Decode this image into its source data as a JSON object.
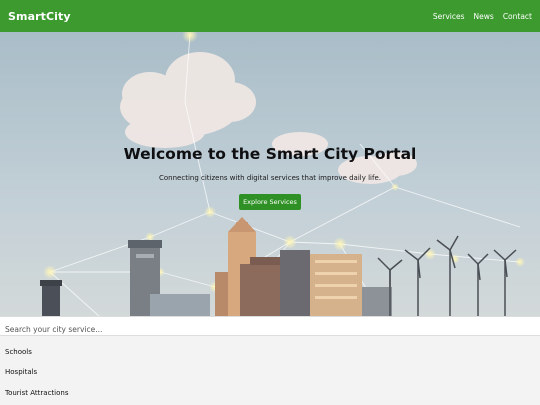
{
  "navbar": {
    "brand": "SmartCity",
    "links": [
      {
        "label": "Services"
      },
      {
        "label": "News"
      },
      {
        "label": "Contact"
      }
    ]
  },
  "hero": {
    "title": "Welcome to the Smart City Portal",
    "subtitle": "Connecting citizens with digital services that improve daily life.",
    "cta_label": "Explore Services"
  },
  "search": {
    "placeholder": "Search your city service...",
    "value": ""
  },
  "results": [
    {
      "label": "Schools"
    },
    {
      "label": "Hospitals"
    },
    {
      "label": "Tourist Attractions"
    }
  ],
  "colors": {
    "brand_green": "#3c9a2f",
    "button_green": "#2f9125",
    "sky": "#b9c9d3"
  }
}
